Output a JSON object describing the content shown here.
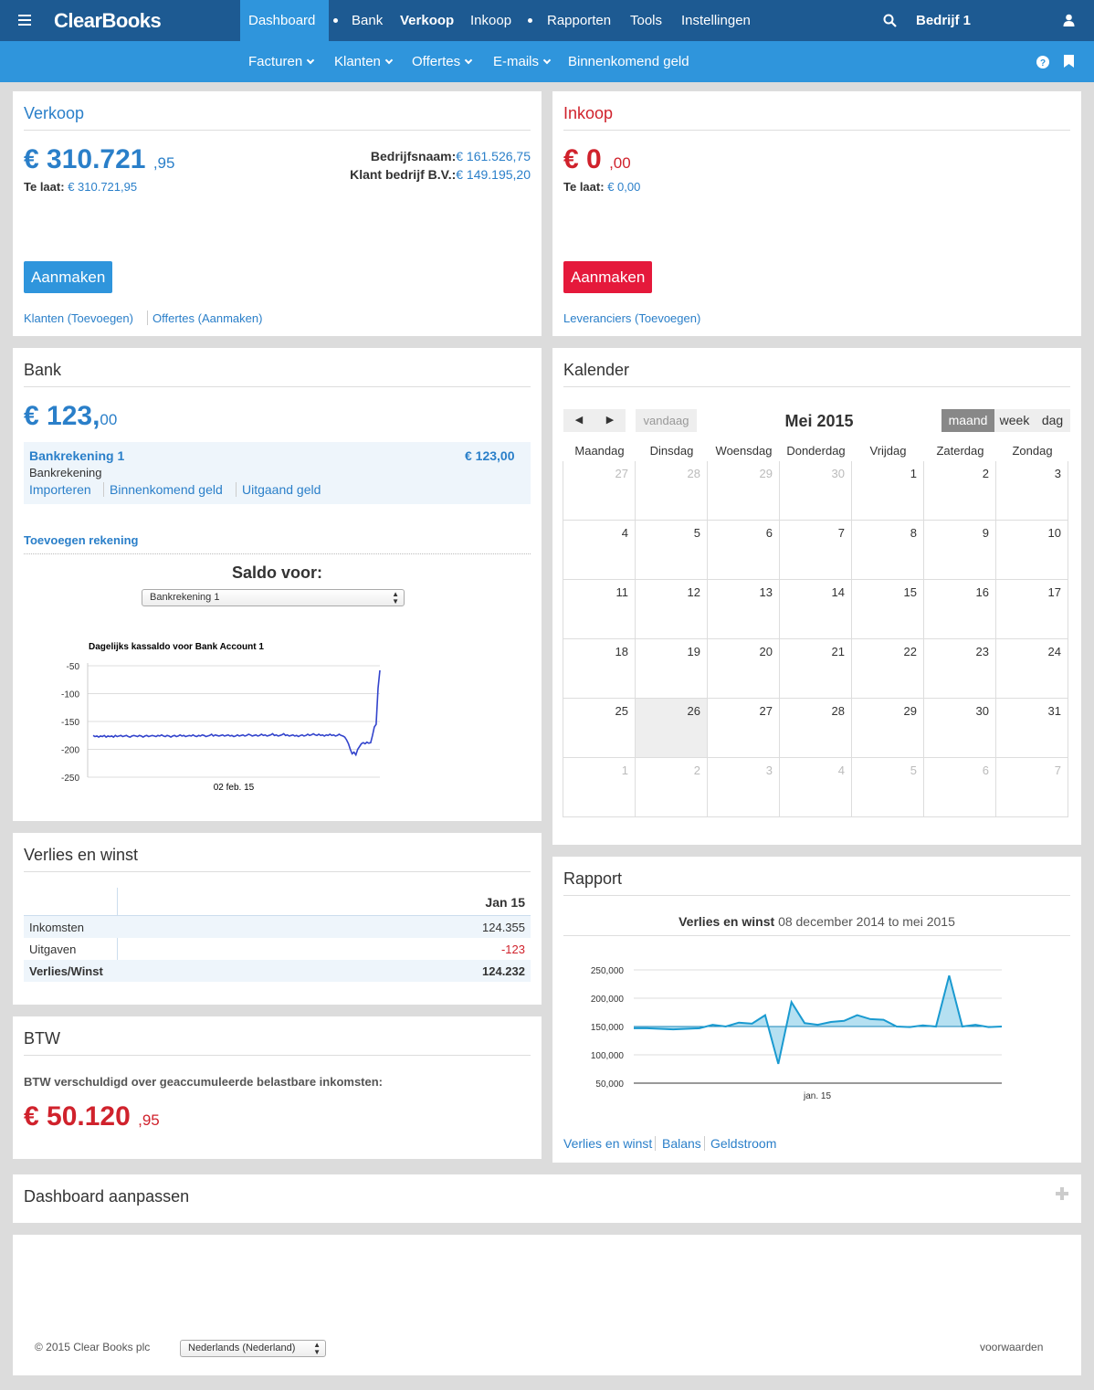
{
  "nav": {
    "brand": "ClearBooks",
    "items": [
      "Dashboard",
      "Bank",
      "Verkoop",
      "Inkoop",
      "Rapporten",
      "Tools",
      "Instellingen"
    ],
    "company": "Bedrijf 1"
  },
  "subnav": {
    "items": [
      "Facturen",
      "Klanten",
      "Offertes",
      "E-mails",
      "Binnenkomend geld"
    ]
  },
  "verkoop": {
    "title": "Verkoop",
    "amount_main": "€ 310.721",
    "amount_cents": ",95",
    "late_label": "Te laat:",
    "late_value": "€ 310.721,95",
    "customers": [
      {
        "name": "Bedrijfsnaam:",
        "value": "€ 161.526,75"
      },
      {
        "name": "Klant bedrijf B.V.:",
        "value": "€ 149.195,20"
      }
    ],
    "button": "Aanmaken",
    "links": [
      "Klanten (Toevoegen)",
      "Offertes (Aanmaken)"
    ]
  },
  "inkoop": {
    "title": "Inkoop",
    "amount_main": "€ 0",
    "amount_cents": ",00",
    "late_label": "Te laat:",
    "late_value": "€ 0,00",
    "button": "Aanmaken",
    "links": [
      "Leveranciers (Toevoegen)"
    ]
  },
  "bank": {
    "title": "Bank",
    "amount_main": "€ 123,",
    "amount_cents": "00",
    "account_name": "Bankrekening 1",
    "account_balance": "€ 123,00",
    "account_type": "Bankrekening",
    "account_links": [
      "Importeren",
      "Binnenkomend geld",
      "Uitgaand geld"
    ],
    "add_link": "Toevoegen rekening",
    "saldo_label": "Saldo voor:",
    "select_value": "Bankrekening 1"
  },
  "kalender": {
    "title": "Kalender",
    "prev_icon": "◀",
    "next_icon": "▶",
    "today": "vandaag",
    "month": "Mei 2015",
    "views": [
      "maand",
      "week",
      "dag"
    ],
    "weekdays": [
      "Maandag",
      "Dinsdag",
      "Woensdag",
      "Donderdag",
      "Vrijdag",
      "Zaterdag",
      "Zondag"
    ],
    "weeks": [
      [
        "27",
        "28",
        "29",
        "30",
        "1",
        "2",
        "3"
      ],
      [
        "4",
        "5",
        "6",
        "7",
        "8",
        "9",
        "10"
      ],
      [
        "11",
        "12",
        "13",
        "14",
        "15",
        "16",
        "17"
      ],
      [
        "18",
        "19",
        "20",
        "21",
        "22",
        "23",
        "24"
      ],
      [
        "25",
        "26",
        "27",
        "28",
        "29",
        "30",
        "31"
      ],
      [
        "1",
        "2",
        "3",
        "4",
        "5",
        "6",
        "7"
      ]
    ]
  },
  "verlies": {
    "title": "Verlies en winst",
    "column": "Jan 15",
    "rows": [
      {
        "label": "Inkomsten",
        "value": "124.355"
      },
      {
        "label": "Uitgaven",
        "value": "-123"
      },
      {
        "label": "Verlies/Winst",
        "value": "124.232"
      }
    ]
  },
  "btw": {
    "title": "BTW",
    "label": "BTW verschuldigd over geaccumuleerde belastbare inkomsten:",
    "amount_main": "€ 50.120",
    "amount_cents": ",95"
  },
  "rapport": {
    "title": "Rapport",
    "subtitle_bold": "Verlies en winst",
    "subtitle_rest": "08 december 2014 to mei 2015",
    "links": [
      "Verlies en winst",
      "Balans",
      "Geldstroom"
    ]
  },
  "dashboard_aanpassen": "Dashboard aanpassen",
  "footer": {
    "copyright": "© 2015 Clear Books plc",
    "language": "Nederlands (Nederland)",
    "terms": "voorwaarden"
  },
  "colors": {
    "topbar": "#1d5a92",
    "subbar": "#2f95dc",
    "blue": "#2a7fc9",
    "red": "#d0222c",
    "button_red": "#e5193b"
  },
  "chart_data": [
    {
      "type": "line",
      "title": "Dagelijks kassaldo voor Bank Account 1",
      "xlabel": "",
      "ylabel": "",
      "x_tick_labels": [
        "02 feb. 15"
      ],
      "y_ticks": [
        -50,
        -100,
        -150,
        -200,
        -250
      ],
      "ylim": [
        -250,
        -45
      ],
      "series": [
        {
          "values": [
            -175,
            -177,
            -176,
            -178,
            -176,
            -177,
            -175,
            -178,
            -176,
            -177,
            -176,
            -178,
            -175,
            -177,
            -176,
            -175,
            -177,
            -176,
            -175,
            -177,
            -178,
            -176,
            -175,
            -176,
            -177,
            -175,
            -176,
            -178,
            -176,
            -175,
            -177,
            -176,
            -175,
            -176,
            -177,
            -175,
            -176,
            -174,
            -176,
            -177,
            -175,
            -176,
            -178,
            -176,
            -175,
            -177,
            -176,
            -174,
            -176,
            -175,
            -177,
            -176,
            -175,
            -176,
            -174,
            -176,
            -177,
            -175,
            -176,
            -174,
            -175,
            -177,
            -176,
            -175,
            -173,
            -176,
            -174,
            -175,
            -176,
            -175,
            -174,
            -176,
            -175,
            -174,
            -176,
            -175,
            -177,
            -176,
            -174,
            -176,
            -175,
            -174,
            -176,
            -175,
            -173,
            -174,
            -176,
            -175,
            -174,
            -176,
            -175,
            -173,
            -175,
            -174,
            -176,
            -175,
            -174,
            -172,
            -175,
            -174,
            -176,
            -175,
            -174,
            -172,
            -175,
            -174,
            -176,
            -175,
            -174,
            -176,
            -175,
            -177,
            -175,
            -174,
            -176,
            -175,
            -173,
            -175,
            -174,
            -172,
            -174,
            -175,
            -173,
            -175,
            -174,
            -176,
            -174,
            -175,
            -173,
            -175,
            -174,
            -176,
            -175,
            -173,
            -175,
            -176,
            -178,
            -183,
            -190,
            -200,
            -208,
            -205,
            -210,
            -200,
            -195,
            -190,
            -188,
            -190,
            -187,
            -189,
            -188,
            -175,
            -160,
            -155,
            -90,
            -58
          ]
        }
      ]
    },
    {
      "type": "area",
      "title": "",
      "x_tick_labels": [
        "jan. 15"
      ],
      "y_ticks": [
        250000,
        200000,
        150000,
        100000,
        50000
      ],
      "ylim": [
        50000,
        250000
      ],
      "series": [
        {
          "values": [
            147000,
            147000,
            146000,
            145000,
            146000,
            147000,
            153000,
            150000,
            157000,
            155000,
            170000,
            84000,
            193000,
            156000,
            153000,
            158000,
            160000,
            170000,
            163000,
            162000,
            150000,
            149000,
            152000,
            150000,
            240000,
            150000,
            153000,
            149000,
            150000
          ]
        }
      ]
    }
  ]
}
